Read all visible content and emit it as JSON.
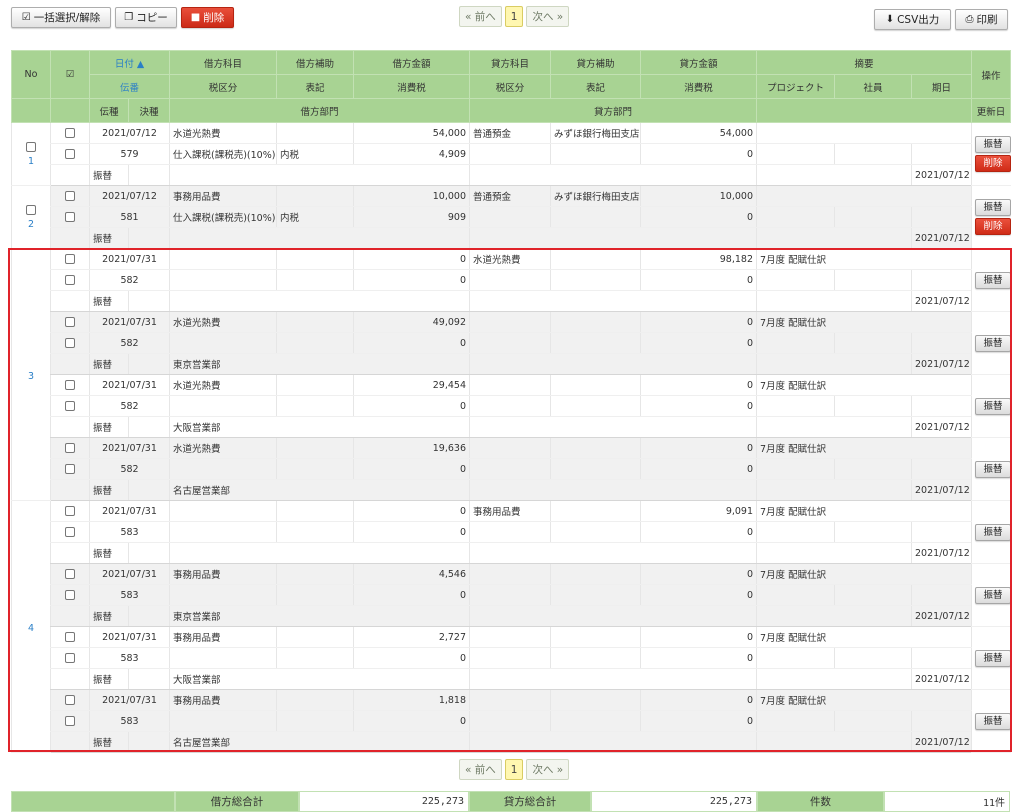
{
  "toolbar": {
    "select_all": "一括選択/解除",
    "copy": "コピー",
    "delete": "削除",
    "csv": "CSV出力",
    "print": "印刷"
  },
  "pager": {
    "prev": "« 前へ",
    "current": "1",
    "next": "次へ »"
  },
  "header": {
    "no": "No",
    "date": "日付 ▲",
    "debit_account": "借方科目",
    "debit_sub": "借方補助",
    "debit_amount": "借方金額",
    "credit_account": "貸方科目",
    "credit_sub": "貸方補助",
    "credit_amount": "貸方金額",
    "summary": "摘要",
    "operation": "操作",
    "slip_no": "伝番",
    "tax_class": "税区分",
    "notation": "表記",
    "tax": "消費税",
    "credit_tax_class": "税区分",
    "credit_notation": "表記",
    "credit_tax": "消費税",
    "project": "プロジェクト",
    "employee": "社員",
    "period": "期日",
    "slip_type": "伝種",
    "settle_type": "決種",
    "debit_dept": "借方部門",
    "credit_dept": "貸方部門",
    "updated": "更新日"
  },
  "buttons": {
    "transfer": "振替",
    "delete": "削除"
  },
  "entries": [
    {
      "no": "1",
      "check": true,
      "delete": true,
      "lines": [
        {
          "date": "2021/07/12",
          "debit_account": "水道光熱費",
          "debit_amount": "54,000",
          "credit_account": "普通預金",
          "credit_sub": "みずほ銀行梅田支店",
          "credit_amount": "54,000",
          "summary": "",
          "slip_no": "579",
          "tax_class": "仕入課税(課税売)(10%)",
          "notation": "内税",
          "tax": "4,909",
          "credit_tax": "0",
          "slip_type": "振替",
          "debit_dept": "",
          "updated": "2021/07/12"
        }
      ]
    },
    {
      "no": "2",
      "check": true,
      "delete": true,
      "lines": [
        {
          "date": "2021/07/12",
          "debit_account": "事務用品費",
          "debit_amount": "10,000",
          "credit_account": "普通預金",
          "credit_sub": "みずほ銀行梅田支店",
          "credit_amount": "10,000",
          "summary": "",
          "slip_no": "581",
          "tax_class": "仕入課税(課税売)(10%)",
          "notation": "内税",
          "tax": "909",
          "credit_tax": "0",
          "slip_type": "振替",
          "debit_dept": "",
          "updated": "2021/07/12"
        }
      ]
    },
    {
      "no": "3",
      "check": false,
      "delete": false,
      "lines": [
        {
          "date": "2021/07/31",
          "debit_account": "",
          "debit_amount": "0",
          "credit_account": "水道光熱費",
          "credit_sub": "",
          "credit_amount": "98,182",
          "summary": "7月度 配賦仕訳",
          "slip_no": "582",
          "tax_class": "",
          "notation": "",
          "tax": "0",
          "credit_tax": "0",
          "slip_type": "振替",
          "debit_dept": "",
          "updated": "2021/07/12"
        },
        {
          "date": "2021/07/31",
          "debit_account": "水道光熱費",
          "debit_amount": "49,092",
          "credit_account": "",
          "credit_sub": "",
          "credit_amount": "0",
          "summary": "7月度 配賦仕訳",
          "slip_no": "582",
          "tax_class": "",
          "notation": "",
          "tax": "0",
          "credit_tax": "0",
          "slip_type": "振替",
          "debit_dept": "東京営業部",
          "updated": "2021/07/12"
        },
        {
          "date": "2021/07/31",
          "debit_account": "水道光熱費",
          "debit_amount": "29,454",
          "credit_account": "",
          "credit_sub": "",
          "credit_amount": "0",
          "summary": "7月度 配賦仕訳",
          "slip_no": "582",
          "tax_class": "",
          "notation": "",
          "tax": "0",
          "credit_tax": "0",
          "slip_type": "振替",
          "debit_dept": "大阪営業部",
          "updated": "2021/07/12"
        },
        {
          "date": "2021/07/31",
          "debit_account": "水道光熱費",
          "debit_amount": "19,636",
          "credit_account": "",
          "credit_sub": "",
          "credit_amount": "0",
          "summary": "7月度 配賦仕訳",
          "slip_no": "582",
          "tax_class": "",
          "notation": "",
          "tax": "0",
          "credit_tax": "0",
          "slip_type": "振替",
          "debit_dept": "名古屋営業部",
          "updated": "2021/07/12"
        }
      ]
    },
    {
      "no": "4",
      "check": false,
      "delete": false,
      "lines": [
        {
          "date": "2021/07/31",
          "debit_account": "",
          "debit_amount": "0",
          "credit_account": "事務用品費",
          "credit_sub": "",
          "credit_amount": "9,091",
          "summary": "7月度 配賦仕訳",
          "slip_no": "583",
          "tax_class": "",
          "notation": "",
          "tax": "0",
          "credit_tax": "0",
          "slip_type": "振替",
          "debit_dept": "",
          "updated": "2021/07/12"
        },
        {
          "date": "2021/07/31",
          "debit_account": "事務用品費",
          "debit_amount": "4,546",
          "credit_account": "",
          "credit_sub": "",
          "credit_amount": "0",
          "summary": "7月度 配賦仕訳",
          "slip_no": "583",
          "tax_class": "",
          "notation": "",
          "tax": "0",
          "credit_tax": "0",
          "slip_type": "振替",
          "debit_dept": "東京営業部",
          "updated": "2021/07/12"
        },
        {
          "date": "2021/07/31",
          "debit_account": "事務用品費",
          "debit_amount": "2,727",
          "credit_account": "",
          "credit_sub": "",
          "credit_amount": "0",
          "summary": "7月度 配賦仕訳",
          "slip_no": "583",
          "tax_class": "",
          "notation": "",
          "tax": "0",
          "credit_tax": "0",
          "slip_type": "振替",
          "debit_dept": "大阪営業部",
          "updated": "2021/07/12"
        },
        {
          "date": "2021/07/31",
          "debit_account": "事務用品費",
          "debit_amount": "1,818",
          "credit_account": "",
          "credit_sub": "",
          "credit_amount": "0",
          "summary": "7月度 配賦仕訳",
          "slip_no": "583",
          "tax_class": "",
          "notation": "",
          "tax": "0",
          "credit_tax": "0",
          "slip_type": "振替",
          "debit_dept": "名古屋営業部",
          "updated": "2021/07/12"
        }
      ]
    }
  ],
  "totals": {
    "debit_label": "借方総合計",
    "debit_value": "225,273",
    "credit_label": "貸方総合計",
    "credit_value": "225,273",
    "count_label": "件数",
    "count_value": "11件"
  },
  "colors": {
    "header_green": "#a8d393",
    "accent_blue": "#2a7fc7",
    "danger_red": "#d83a25",
    "highlight_red": "#e0232a"
  }
}
